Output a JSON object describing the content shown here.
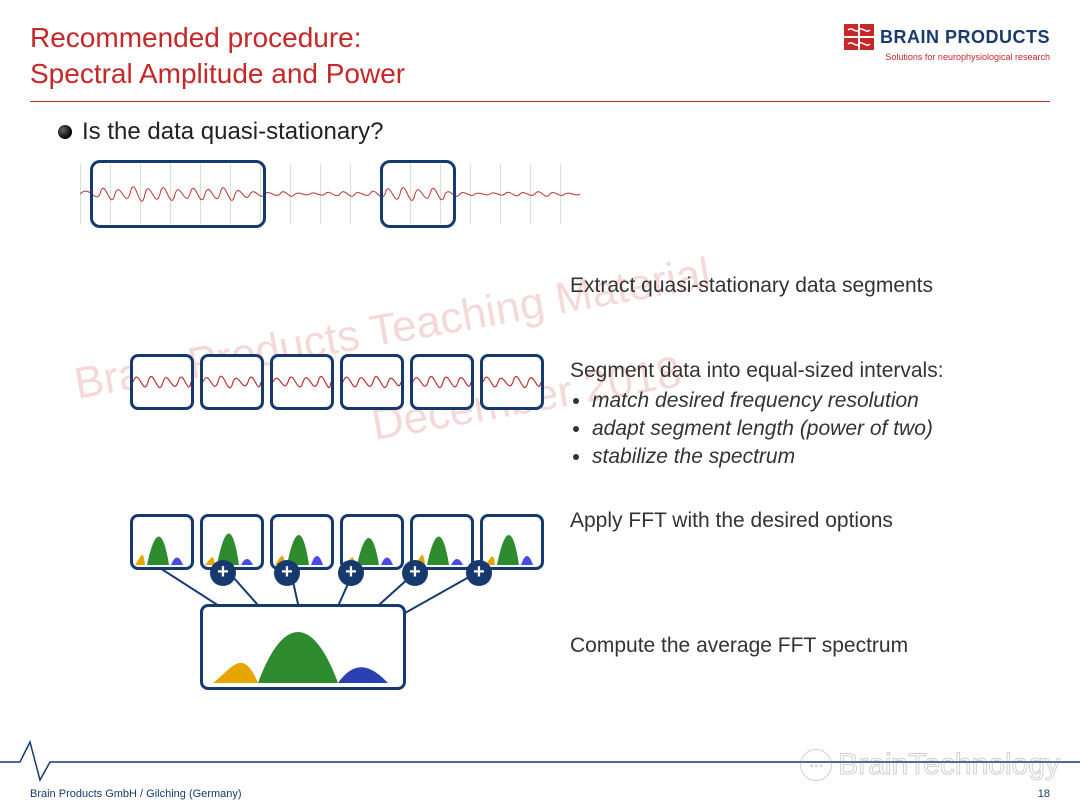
{
  "header": {
    "title_line1": "Recommended procedure:",
    "title_line2": "Spectral Amplitude and Power",
    "logo_text": "BRAIN PRODUCTS",
    "logo_tagline": "Solutions for neurophysiological research"
  },
  "bullet": {
    "question": "Is the data quasi-stationary?"
  },
  "steps": {
    "extract": "Extract quasi-stationary data segments",
    "segment_intro": "Segment data into equal-sized intervals:",
    "segment_items": [
      "match desired frequency resolution",
      "adapt segment length (power of two)",
      "stabilize the spectrum"
    ],
    "fft": "Apply FFT with the desired options",
    "average": "Compute the average FFT spectrum"
  },
  "watermark": {
    "line1": "Brain Products Teaching Material",
    "line2": "December 2018",
    "corner": "BrainTechnology"
  },
  "footer": {
    "left": "Brain Products GmbH / Gilching (Germany)",
    "page": "18"
  },
  "colors": {
    "accent": "#c62828",
    "navy": "#173a6e"
  }
}
